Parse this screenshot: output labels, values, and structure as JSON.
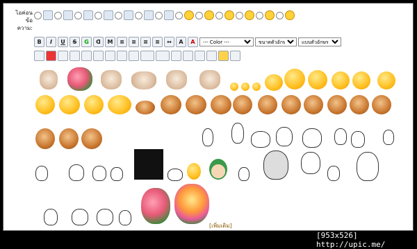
{
  "label": {
    "line1": "ไอค่อน",
    "line2": "ข้อ",
    "line3": "ความ:"
  },
  "toolbar": {
    "buttons": [
      "B",
      "I",
      "U",
      "S",
      "G",
      "ᗡ",
      "M",
      "≡",
      "≡",
      "≡",
      "≡",
      "↔",
      "A",
      "A"
    ],
    "color_select": "--- Color ---",
    "size_select": "ขนาดตัวอักษร",
    "font_select": "แบบตัวอักษร"
  },
  "more_link": "[เพิ่มเติม]",
  "caption": "[953x526] http://upic.me/"
}
